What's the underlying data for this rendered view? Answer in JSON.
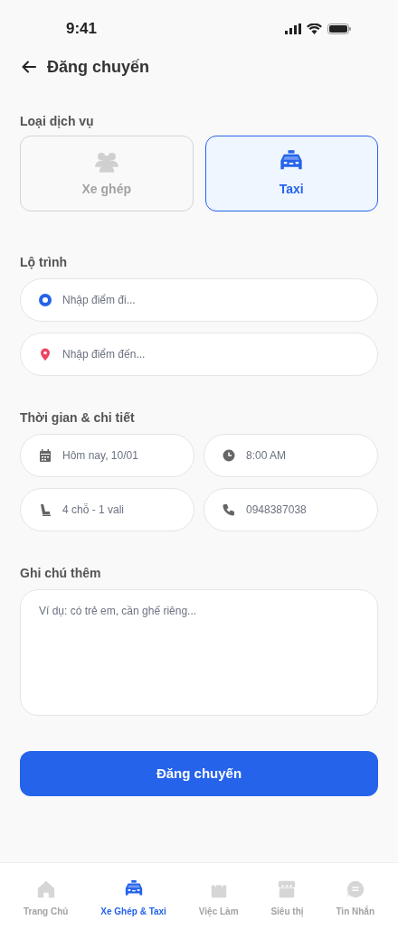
{
  "status_bar": {
    "time": "9:41"
  },
  "header": {
    "title": "Đăng chuyến"
  },
  "service": {
    "label": "Loại dịch vụ",
    "options": [
      {
        "kind": "shared",
        "label": "Xe ghép",
        "selected": false
      },
      {
        "kind": "taxi",
        "label": "Taxi",
        "selected": true
      }
    ]
  },
  "route": {
    "label": "Lộ trình",
    "fields": [
      {
        "kind": "origin",
        "placeholder": "Nhập điểm đi..."
      },
      {
        "kind": "destination",
        "placeholder": "Nhập điểm đến..."
      }
    ]
  },
  "details": {
    "label": "Thời gian & chi tiết",
    "fields": [
      {
        "kind": "date",
        "value": "Hôm nay, 10/01"
      },
      {
        "kind": "time",
        "value": "8:00 AM"
      },
      {
        "kind": "seat",
        "value": "4 chỗ - 1 vali"
      },
      {
        "kind": "phone",
        "value": "0948387038"
      }
    ]
  },
  "notes": {
    "label": "Ghi chú thêm",
    "placeholder": "Ví dụ: có trẻ em, cần ghế riêng..."
  },
  "submit_button": "Đăng chuyến",
  "bottom_nav": [
    {
      "kind": "home",
      "label": "Trang Chủ",
      "selected": false
    },
    {
      "kind": "taxi",
      "label": "Xe Ghép & Taxi",
      "selected": true
    },
    {
      "kind": "bag",
      "label": "Việc Làm",
      "selected": false
    },
    {
      "kind": "store",
      "label": "Siêu thị",
      "selected": false
    },
    {
      "kind": "chat",
      "label": "Tin Nhắn",
      "selected": false
    }
  ]
}
